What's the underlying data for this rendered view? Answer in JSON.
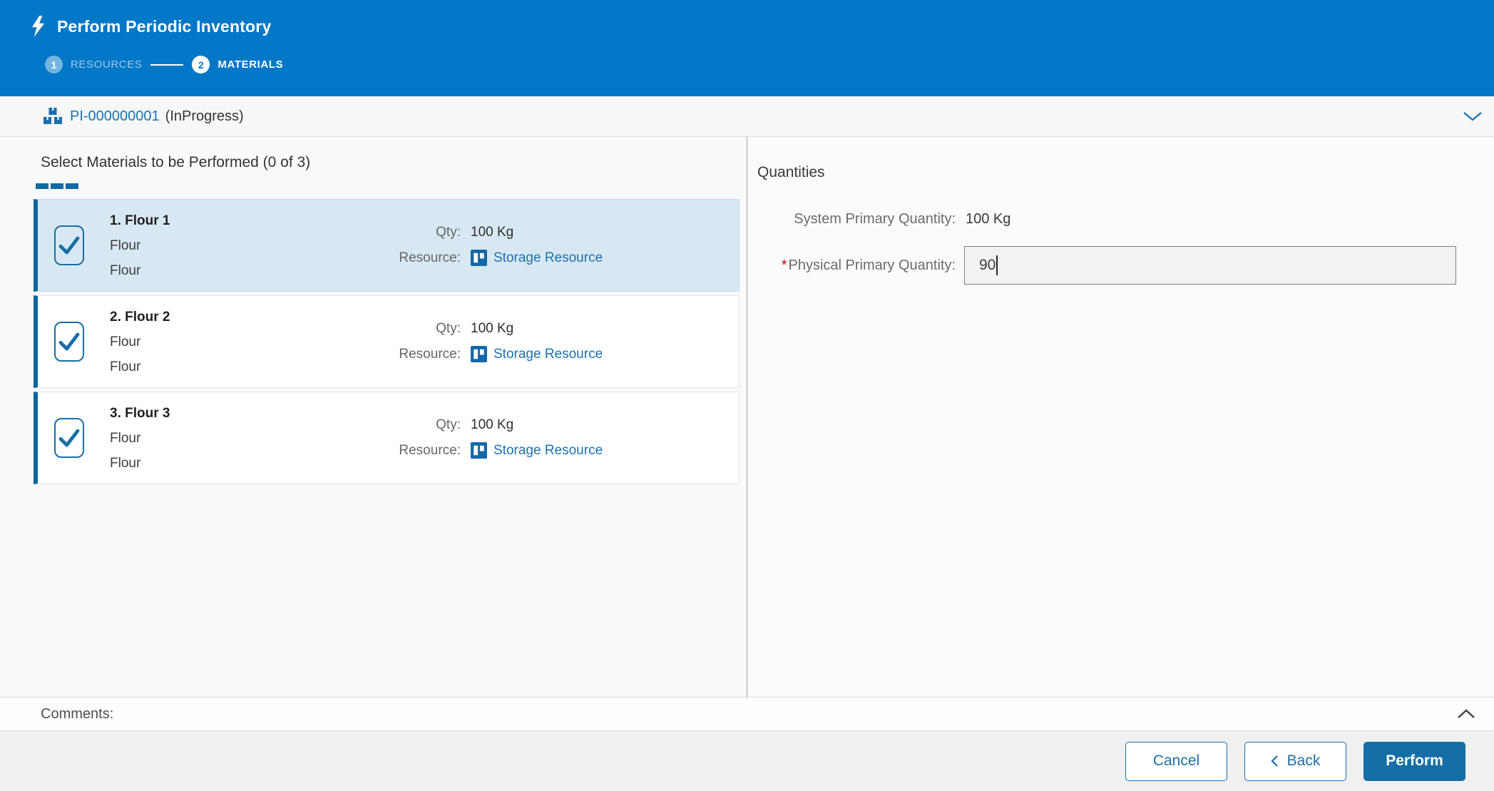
{
  "header": {
    "title": "Perform Periodic Inventory",
    "steps": [
      {
        "number": "1",
        "label": "RESOURCES"
      },
      {
        "number": "2",
        "label": "MATERIALS"
      }
    ]
  },
  "context_bar": {
    "id": "PI-000000001",
    "status": "(InProgress)"
  },
  "materials_panel": {
    "title": "Select Materials to be Performed (0 of 3)",
    "items": [
      {
        "name": "1. Flour 1",
        "line2": "Flour",
        "line3": "Flour",
        "qty_label": "Qty:",
        "qty_value": "100 Kg",
        "resource_label": "Resource:",
        "resource_link": "Storage Resource",
        "checked": true,
        "selected": true
      },
      {
        "name": "2. Flour 2",
        "line2": "Flour",
        "line3": "Flour",
        "qty_label": "Qty:",
        "qty_value": "100 Kg",
        "resource_label": "Resource:",
        "resource_link": "Storage Resource",
        "checked": true,
        "selected": false
      },
      {
        "name": "3. Flour 3",
        "line2": "Flour",
        "line3": "Flour",
        "qty_label": "Qty:",
        "qty_value": "100 Kg",
        "resource_label": "Resource:",
        "resource_link": "Storage Resource",
        "checked": true,
        "selected": false
      }
    ]
  },
  "quantities_panel": {
    "title": "Quantities",
    "system_label": "System Primary Quantity:",
    "system_value": "100 Kg",
    "required_marker": "*",
    "physical_label": "Physical Primary Quantity:",
    "physical_value": "90"
  },
  "comments": {
    "label": "Comments:"
  },
  "footer": {
    "cancel_label": "Cancel",
    "back_label": "Back",
    "perform_label": "Perform"
  },
  "colors": {
    "header_blue": "#0177c8",
    "link_blue": "#1a72b0",
    "action_blue": "#156fa6",
    "selected_item_bg": "#d8e8f3",
    "item_accent_border": "#0e659c",
    "required_red": "#cc0000"
  }
}
